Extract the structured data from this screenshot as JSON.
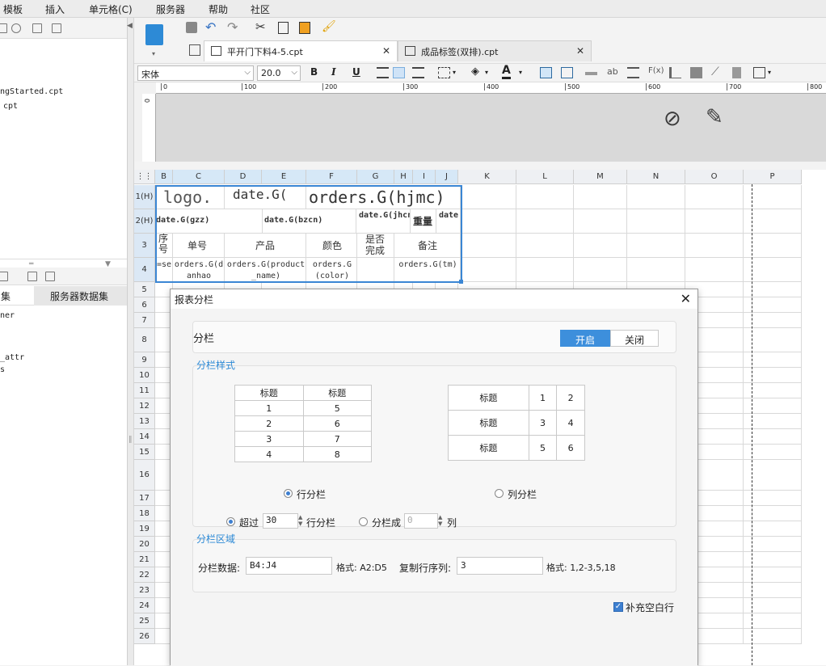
{
  "menu": [
    "模板",
    "插入",
    "单元格(C)",
    "服务器",
    "帮助",
    "社区"
  ],
  "left_panel": {
    "files": [
      "ngStarted.cpt",
      "cpt"
    ],
    "dataset_tabs": [
      "集",
      "服务器数据集"
    ],
    "dataset_items": [
      "ner",
      "_attr",
      "s"
    ]
  },
  "tabs": [
    {
      "label": "平开门下料4-5.cpt",
      "active": true
    },
    {
      "label": "成品标签(双排).cpt",
      "active": false
    }
  ],
  "format_bar": {
    "font_name": "宋体",
    "font_size": "20.0",
    "bold": "B",
    "italic": "I",
    "underline": "U",
    "fx": "F(x)",
    "ab": "ab"
  },
  "ruler_ticks": [
    "0",
    "100",
    "200",
    "300",
    "400",
    "500",
    "600",
    "700",
    "800"
  ],
  "vruler_tick": "0",
  "columns": [
    "B",
    "C",
    "D",
    "E",
    "F",
    "G",
    "H",
    "I",
    "J",
    "K",
    "L",
    "M",
    "N",
    "O",
    "P"
  ],
  "rows": [
    "1(H)",
    "2(H)",
    "3",
    "4",
    "5",
    "6",
    "7",
    "8",
    "9",
    "10",
    "11",
    "12",
    "13",
    "14",
    "15",
    "16",
    "17",
    "18",
    "19",
    "20",
    "21",
    "22",
    "23",
    "24",
    "25",
    "26"
  ],
  "cells": {
    "r1_logo": "logo.",
    "r1_date": "date.G(",
    "r1_orders": "orders.G(hjmc)",
    "r2_gzz": "date.G(gzz)",
    "r2_bzcn": "date.G(bzcn)",
    "r2_jhcn": "date.G(jhcn)",
    "r2_weight": "重量",
    "r2_date": "date.",
    "r3_seq": "序号",
    "r3_no": "单号",
    "r3_product": "产品",
    "r3_color": "颜色",
    "r3_done": "是否完成",
    "r3_remark": "备注",
    "r4_seq": "=se",
    "r4_no": "orders.G(danhao",
    "r4_product": "orders.G(product_name)",
    "r4_color": "orders.G(color)",
    "r4_tm": "orders.G(tm)"
  },
  "dialog": {
    "title": "报表分栏",
    "section_label": "分栏",
    "toggle_on": "开启",
    "toggle_off": "关闭",
    "style_label": "分栏样式",
    "row_preview": {
      "headers": [
        "标题",
        "标题"
      ],
      "rows": [
        [
          "1",
          "5"
        ],
        [
          "2",
          "6"
        ],
        [
          "3",
          "7"
        ],
        [
          "4",
          "8"
        ]
      ]
    },
    "col_preview": {
      "rows": [
        [
          "标题",
          "1",
          "2"
        ],
        [
          "标题",
          "3",
          "4"
        ],
        [
          "标题",
          "5",
          "6"
        ]
      ]
    },
    "row_split_label": "行分栏",
    "col_split_label": "列分栏",
    "exceed_label": "超过",
    "exceed_value": "30",
    "exceed_suffix": "行分栏",
    "split_into_label": "分栏成",
    "split_into_value": "0",
    "split_into_suffix": "列",
    "area_label": "分栏区域",
    "data_label": "分栏数据:",
    "data_value": "B4:J4",
    "format1": "格式: A2:D5",
    "copy_label": "复制行序列:",
    "copy_value": "3",
    "format2": "格式: 1,2-3,5,18",
    "fill_blank": "补充空白行",
    "fill_checked": "✓"
  }
}
